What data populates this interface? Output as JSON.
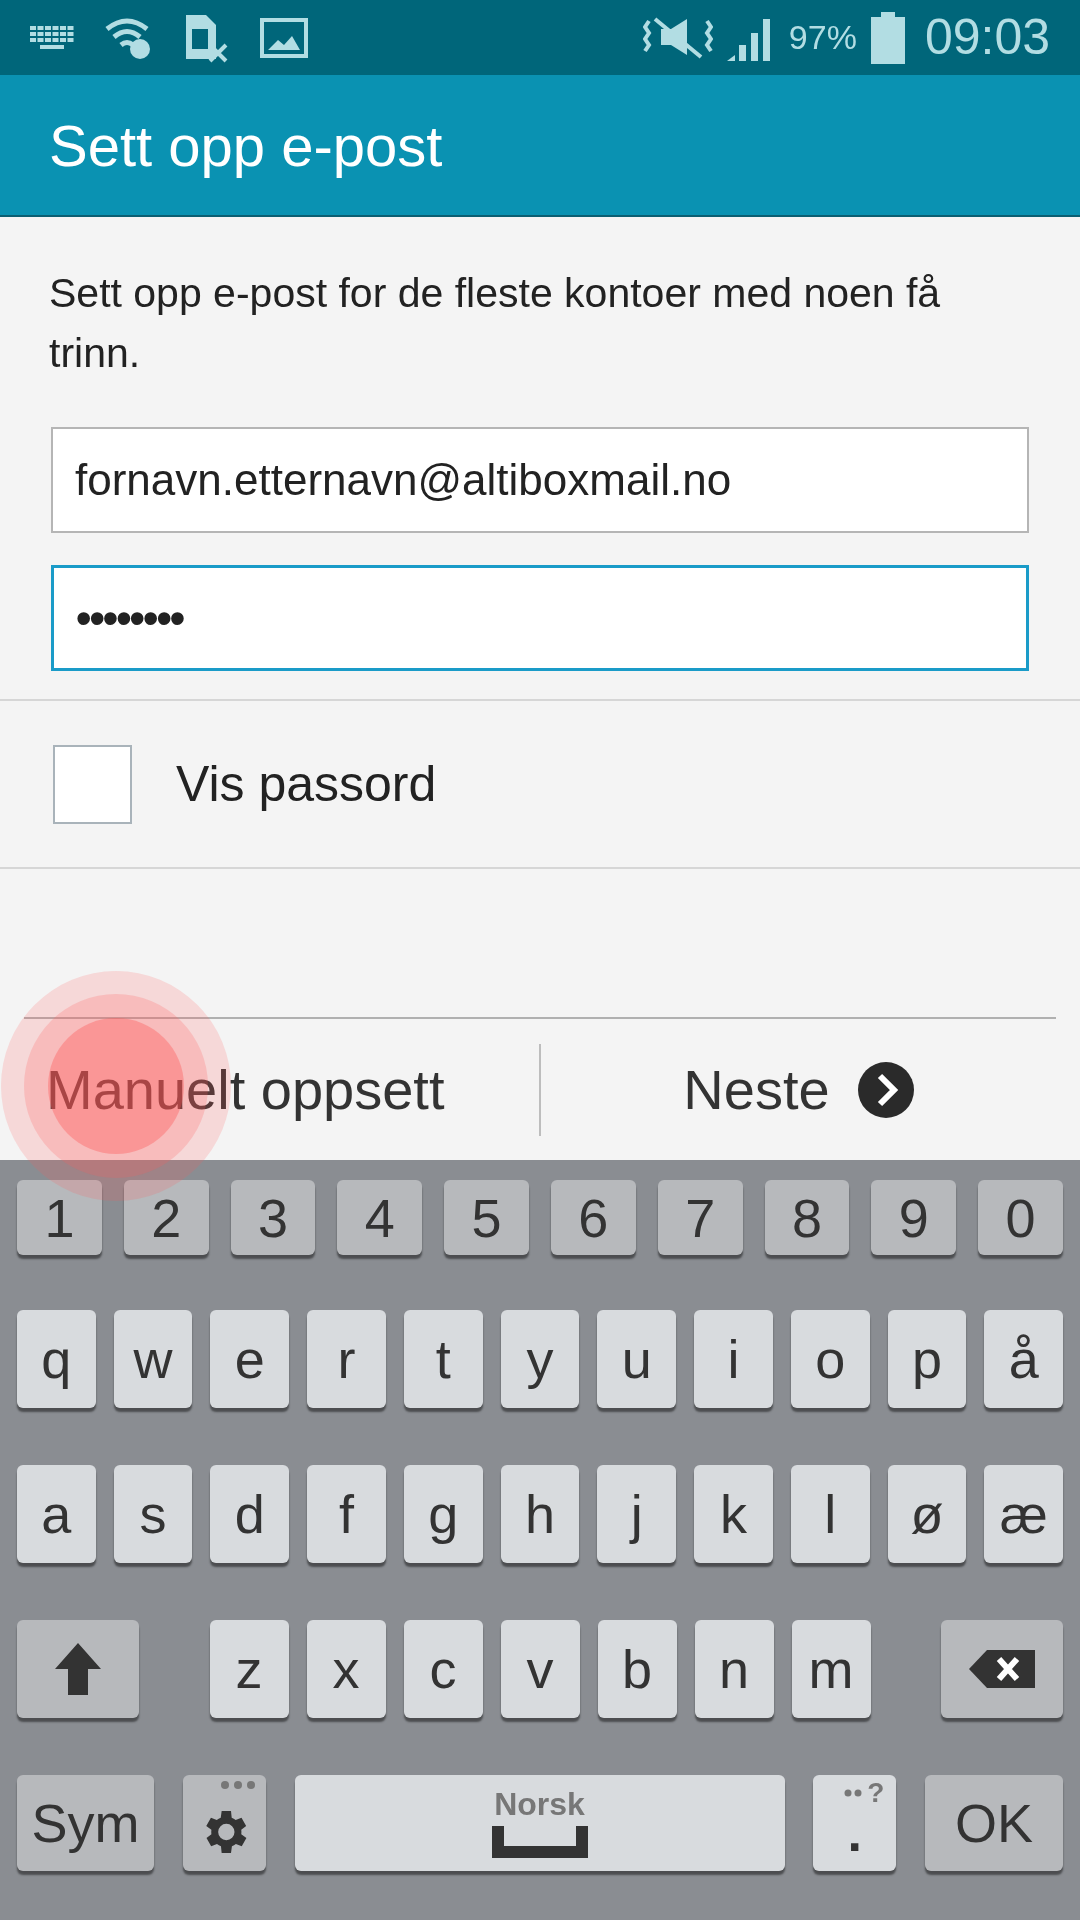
{
  "status_bar": {
    "battery": "97%",
    "time": "09:03"
  },
  "header": {
    "title": "Sett opp e-post"
  },
  "intro": "Sett opp e-post for de fleste kontoer med noen få trinn.",
  "fields": [
    {
      "kind": "email",
      "value": "fornavn.etternavn@altiboxmail.no",
      "focused": false
    },
    {
      "kind": "password",
      "value": "••••••••",
      "focused": true
    }
  ],
  "show_password": {
    "label": "Vis passord",
    "checked": false
  },
  "actions": {
    "manual": "Manuelt oppsett",
    "next": "Neste"
  },
  "touch_indicator": {
    "kind": "tap"
  },
  "keyboard": {
    "rows": [
      {
        "keys": [
          {
            "kind": "num",
            "label": "1"
          },
          {
            "kind": "num",
            "label": "2"
          },
          {
            "kind": "num",
            "label": "3"
          },
          {
            "kind": "num",
            "label": "4"
          },
          {
            "kind": "num",
            "label": "5"
          },
          {
            "kind": "num",
            "label": "6"
          },
          {
            "kind": "num",
            "label": "7"
          },
          {
            "kind": "num",
            "label": "8"
          },
          {
            "kind": "num",
            "label": "9"
          },
          {
            "kind": "num",
            "label": "0"
          }
        ]
      },
      {
        "keys": [
          {
            "kind": "char",
            "label": "q"
          },
          {
            "kind": "char",
            "label": "w"
          },
          {
            "kind": "char",
            "label": "e"
          },
          {
            "kind": "char",
            "label": "r"
          },
          {
            "kind": "char",
            "label": "t"
          },
          {
            "kind": "char",
            "label": "y"
          },
          {
            "kind": "char",
            "label": "u"
          },
          {
            "kind": "char",
            "label": "i"
          },
          {
            "kind": "char",
            "label": "o"
          },
          {
            "kind": "char",
            "label": "p"
          },
          {
            "kind": "char",
            "label": "å"
          }
        ]
      },
      {
        "keys": [
          {
            "kind": "char",
            "label": "a"
          },
          {
            "kind": "char",
            "label": "s"
          },
          {
            "kind": "char",
            "label": "d"
          },
          {
            "kind": "char",
            "label": "f"
          },
          {
            "kind": "char",
            "label": "g"
          },
          {
            "kind": "char",
            "label": "h"
          },
          {
            "kind": "char",
            "label": "j"
          },
          {
            "kind": "char",
            "label": "k"
          },
          {
            "kind": "char",
            "label": "l"
          },
          {
            "kind": "char",
            "label": "ø"
          },
          {
            "kind": "char",
            "label": "æ"
          }
        ]
      },
      {
        "keys": [
          {
            "kind": "shift"
          },
          {
            "kind": "char",
            "label": "z"
          },
          {
            "kind": "char",
            "label": "x"
          },
          {
            "kind": "char",
            "label": "c"
          },
          {
            "kind": "char",
            "label": "v"
          },
          {
            "kind": "char",
            "label": "b"
          },
          {
            "kind": "char",
            "label": "n"
          },
          {
            "kind": "char",
            "label": "m"
          },
          {
            "kind": "backspace"
          }
        ]
      },
      {
        "keys": [
          {
            "kind": "sym",
            "label": "Sym"
          },
          {
            "kind": "settings"
          },
          {
            "kind": "space",
            "label": "Norsk"
          },
          {
            "kind": "period",
            "label": ".",
            "hint": "?"
          },
          {
            "kind": "ok",
            "label": "OK"
          }
        ]
      }
    ]
  }
}
